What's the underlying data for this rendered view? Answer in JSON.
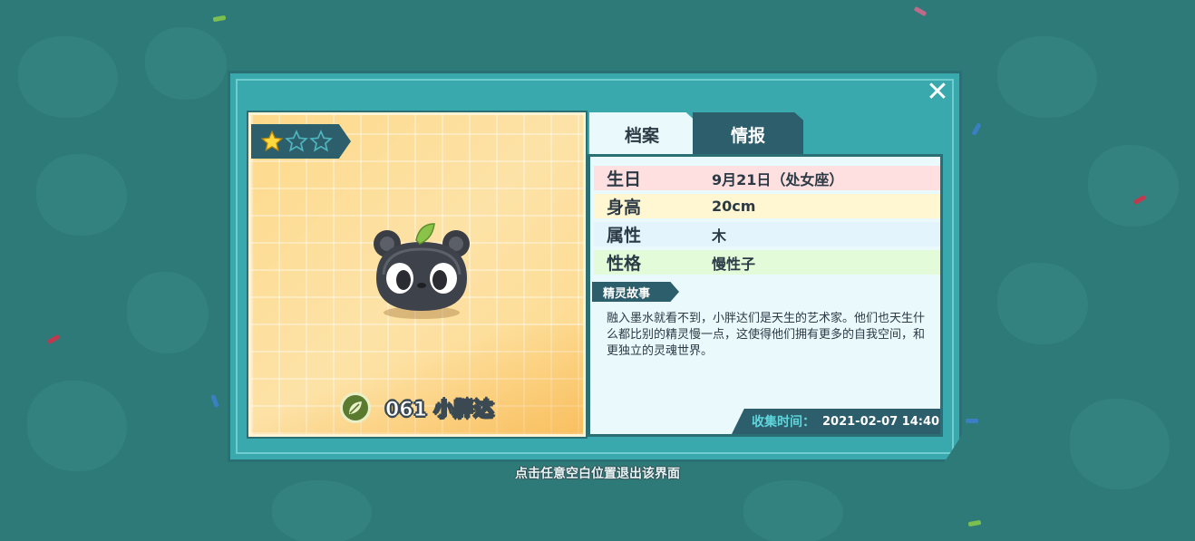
{
  "colors": {
    "background": "#2e7a78",
    "panel": "#3aa9ae",
    "dark_accent": "#2d5e6c",
    "card_yellow": "#fdd98a",
    "star_filled": "#ffd93d"
  },
  "window": {
    "close_icon": "close-icon",
    "hint": "点击任意空白位置退出该界面"
  },
  "creature": {
    "stars_total": 3,
    "stars_filled": 1,
    "element_icon": "leaf-element-icon",
    "name": "061 小胖达"
  },
  "tabs": [
    {
      "label": "档案",
      "active": true
    },
    {
      "label": "情报",
      "active": false
    }
  ],
  "profile": {
    "rows": [
      {
        "label": "生日",
        "value": "9月21日（处女座）",
        "color": "#ffe0e0"
      },
      {
        "label": "身高",
        "value": "20cm",
        "color": "#fff6d2"
      },
      {
        "label": "属性",
        "value": "木",
        "color": "#e4f4fd"
      },
      {
        "label": "性格",
        "value": "慢性子",
        "color": "#e3fbd9"
      }
    ]
  },
  "story": {
    "tag": "精灵故事",
    "text": "融入墨水就看不到，小胖达们是天生的艺术家。他们也天生什么都比别的精灵慢一点，这使得他们拥有更多的自我空间，和更独立的灵魂世界。"
  },
  "collect": {
    "label": "收集时间：",
    "value": "2021-02-07 14:40"
  }
}
